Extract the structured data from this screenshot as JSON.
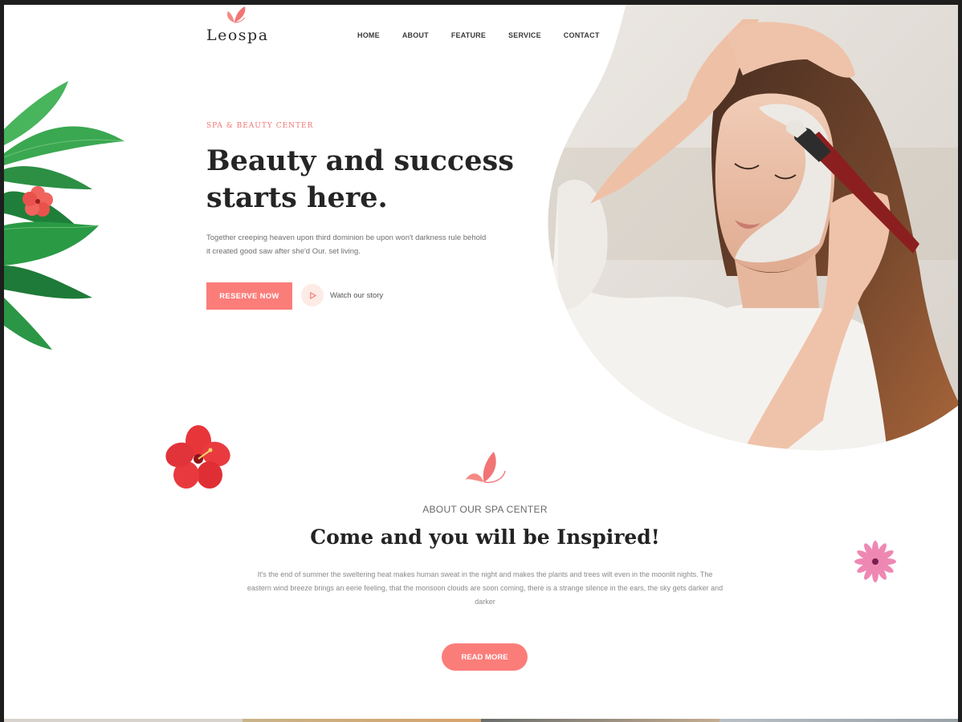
{
  "brand": {
    "name": "Leospa",
    "accent": "#fb7d7a",
    "eyebrow_color": "#f27474"
  },
  "nav": {
    "items": [
      "HOME",
      "ABOUT",
      "FEATURE",
      "SERVICE",
      "CONTACT"
    ]
  },
  "hero": {
    "eyebrow": "SPA & BEAUTY CENTER",
    "title_line1": "Beauty and success",
    "title_line2": "starts here.",
    "description": "Together creeping heaven upon third dominion be upon won't darkness rule behold it created good saw after she'd Our. set living.",
    "reserve_label": "RESERVE NOW",
    "watch_label": "Watch our story"
  },
  "about": {
    "eyebrow": "ABOUT OUR SPA CENTER",
    "title": "Come and you will be Inspired!",
    "description": "It's the end of summer the sweltering heat makes human sweat in the night and makes the plants and trees wilt even in the moonlit nights. The eastern wind breeze brings an eerie feeling, that the monsoon clouds are soon coming, there is a strange silence in the ears, the sky gets darker and darker",
    "read_more_label": "READ MORE"
  },
  "icons": [
    "butterfly-logo-icon",
    "play-icon",
    "palm-leaves-decoration",
    "red-hibiscus-flower",
    "pink-flower",
    "butterfly-section-icon"
  ]
}
